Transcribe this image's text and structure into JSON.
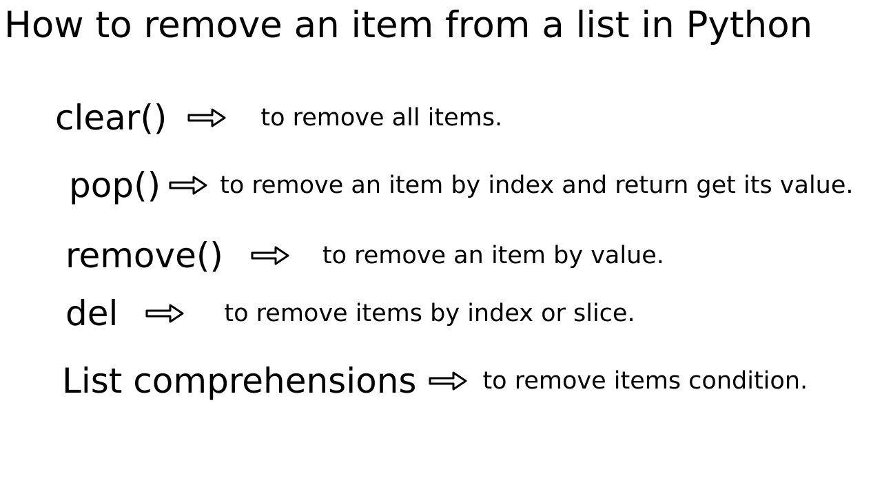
{
  "title": "How to remove an item from a list in Python",
  "items": [
    {
      "method": "clear()",
      "description": "to remove all items."
    },
    {
      "method": "pop()",
      "description": "to remove an item by index and return get its value."
    },
    {
      "method": "remove()",
      "description": "to remove an item by value."
    },
    {
      "method": "del",
      "description": "to remove items by index or slice."
    },
    {
      "method": "List comprehensions",
      "description": "to remove items condition."
    }
  ]
}
